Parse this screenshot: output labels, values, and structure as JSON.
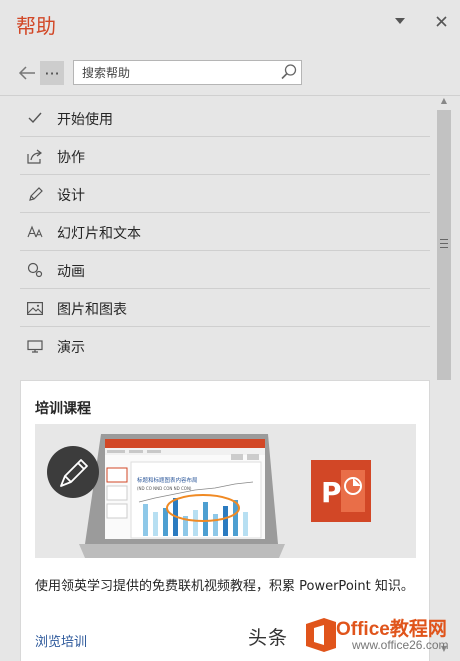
{
  "panel": {
    "title": "帮助",
    "dropdown_icon": "caret-down-icon",
    "close_icon": "close-icon"
  },
  "nav": {
    "back_icon": "arrow-left-icon",
    "more_label": "···",
    "search": {
      "placeholder": "搜索帮助",
      "value": "",
      "icon": "search-icon"
    }
  },
  "topics": [
    {
      "label": "开始使用",
      "icon": "checkmark-icon"
    },
    {
      "label": "协作",
      "icon": "share-icon"
    },
    {
      "label": "设计",
      "icon": "pencil-icon"
    },
    {
      "label": "幻灯片和文本",
      "icon": "font-size-icon"
    },
    {
      "label": "动画",
      "icon": "animation-icon"
    },
    {
      "label": "图片和图表",
      "icon": "picture-icon"
    },
    {
      "label": "演示",
      "icon": "monitor-icon"
    }
  ],
  "training": {
    "title": "培训课程",
    "description": "使用领英学习提供的免费联机视频教程，积累 PowerPoint 知识。",
    "link": "浏览培训",
    "slide_title": "标题和标题图表内容布局",
    "slide_subtitle": "(ND CO NND CON ND CON)"
  },
  "watermark": {
    "toutiao": "头条",
    "site": "Office教程网",
    "url": "www.office26.com"
  },
  "colors": {
    "accent": "#d24726",
    "link": "#2b579a",
    "panel_bg": "#e6e6e6"
  }
}
